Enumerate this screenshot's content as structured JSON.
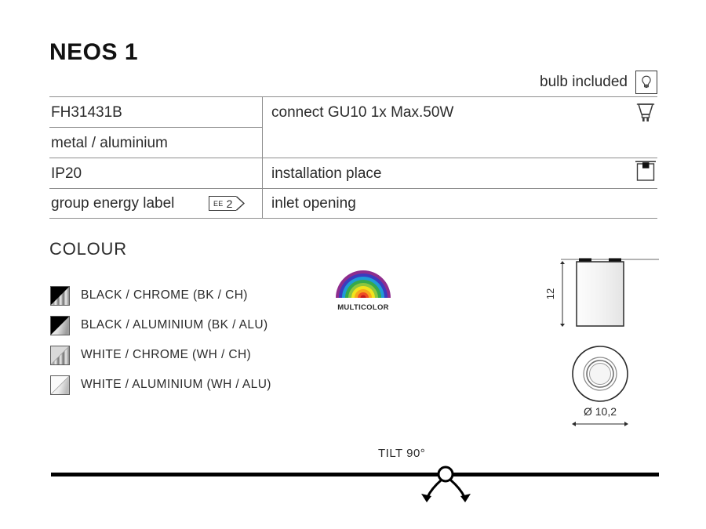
{
  "product": {
    "title": "NEOS 1"
  },
  "header": {
    "bulb_included_label": "bulb included",
    "bulb_icon": "light-bulb-icon"
  },
  "spec_table": {
    "rows": [
      {
        "left": "FH31431B",
        "right": "connect GU10 1x Max.50W"
      },
      {
        "left": "metal / aluminium",
        "right": ""
      },
      {
        "left": "IP20",
        "right": "installation place"
      },
      {
        "left": "group energy label",
        "right": "inlet opening"
      }
    ],
    "energy_label": {
      "prefix": "EE",
      "value": "2"
    },
    "icons": {
      "lamp": "gu10-lamp-icon",
      "installation": "ceiling-mount-icon"
    }
  },
  "colour_section": {
    "heading": "COLOUR",
    "options": [
      {
        "label": "BLACK / CHROME (BK / CH)",
        "base": "#000000",
        "finish": "chrome"
      },
      {
        "label": "BLACK / ALUMINIUM (BK / ALU)",
        "base": "#000000",
        "finish": "aluminium"
      },
      {
        "label": "WHITE / CHROME (WH / CH)",
        "base": "#ffffff",
        "finish": "chrome"
      },
      {
        "label": "WHITE / ALUMINIUM (WH / ALU)",
        "base": "#ffffff",
        "finish": "aluminium"
      }
    ]
  },
  "multicolor": {
    "label": "MULTICOLOR",
    "bands": [
      "#8e2d8e",
      "#3b3bbf",
      "#1f9ad6",
      "#36a94b",
      "#8cc63f",
      "#f2e31c",
      "#f7a81b",
      "#ef4e23",
      "#d81e1e"
    ]
  },
  "dimensions": {
    "height_label": "12",
    "diameter_label": "Ø 10,2"
  },
  "tilt": {
    "label": "TILT 90°"
  }
}
